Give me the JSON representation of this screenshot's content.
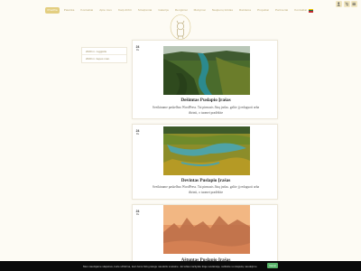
{
  "nav": {
    "items": [
      "Pradžia",
      "Paieška",
      "Kontaktai",
      "Apie mus",
      "Kaip dirbti",
      "Straipsniai",
      "Galerija",
      "Renginiai",
      "Mokymai",
      "Naujienų tinklas",
      "Reklama",
      "Projektai",
      "Partneriai",
      "Kontaktai"
    ],
    "active_index": 0
  },
  "colors": {
    "accent": "#e3ce80",
    "background": "#fdfbf4",
    "cookie_button": "#58b368"
  },
  "tools": [
    "user-icon",
    "cart-icon",
    "menu-icon"
  ],
  "sidebar": {
    "links": [
      "2020 m. rugpjūtis",
      "2020 m. liepos mėn."
    ]
  },
  "posts": [
    {
      "day": "24",
      "month": "Ru",
      "title": "Dešimtas Puslapio Įrašas",
      "excerpt_1": "Sveikiname paskelbus WordPress. Tai pirmasis Jūsų įrašas. galite jį redaguoti arba",
      "excerpt_2": "ištrinti, o tuomet pradėkite"
    },
    {
      "day": "24",
      "month": "Ru",
      "title": "Devintas Puslapio Įrašas",
      "excerpt_1": "Sveikiname paskelbus WordPress. Tai pirmasis Jūsų įrašas. galite jį redaguoti arba",
      "excerpt_2": "ištrinti, o tuomet pradėkite"
    },
    {
      "day": "24",
      "month": "Ru",
      "title": "Aštuntas Puslapio Įrašas"
    }
  ],
  "cookie": {
    "text": "Mes naudojame slapukus, kurie užtikrina, kad Jums būtų patogu naudotis svetaine. Jei toliau naršysite šioje svetainėje, sutiksite su slapukų naudojimu.",
    "button": "Gerai"
  }
}
